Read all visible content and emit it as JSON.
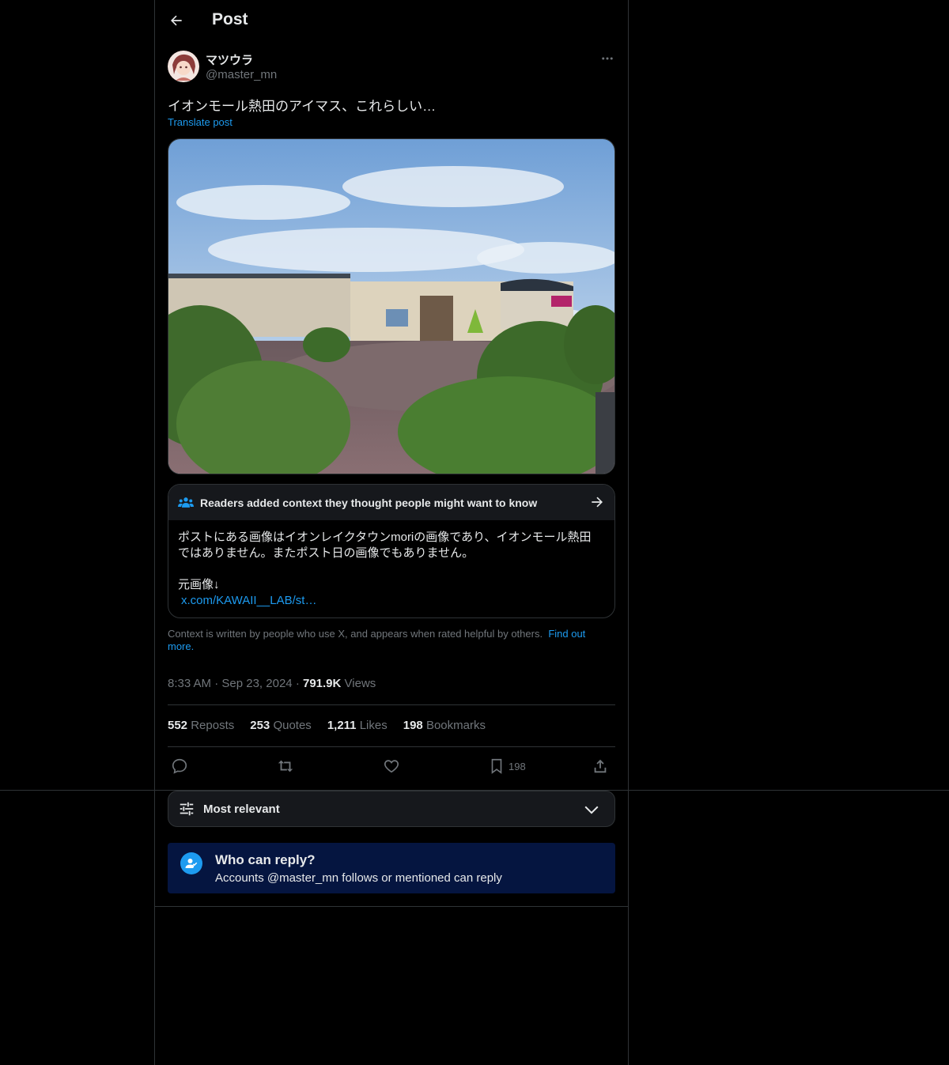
{
  "header": {
    "title": "Post"
  },
  "author": {
    "name": "マツウラ",
    "handle": "@master_mn"
  },
  "post": {
    "text": "イオンモール熱田のアイマス、これらしい…",
    "translate_label": "Translate post"
  },
  "community_note": {
    "title": "Readers added context they thought people might want to know",
    "line1": "ポストにある画像はイオンレイクタウンmoriの画像であり、イオンモール熱田",
    "line2": "ではありません。またポスト日の画像でもありません。",
    "line3": "元画像↓",
    "link": "x.com/KAWAII__LAB/st…"
  },
  "disclaimer": {
    "text": "Context is written by people who use X, and appears when rated helpful by others.",
    "link1": "Find out",
    "link2": "more."
  },
  "meta": {
    "time": "8:33 AM",
    "sep1": "·",
    "date": "Sep 23, 2024",
    "sep2": "·",
    "views_count": "791.9K",
    "views_label": "Views"
  },
  "stats": [
    {
      "count": "552",
      "label": "Reposts"
    },
    {
      "count": "253",
      "label": "Quotes"
    },
    {
      "count": "1,211",
      "label": "Likes"
    },
    {
      "count": "198",
      "label": "Bookmarks"
    }
  ],
  "actions": {
    "bookmark_count": "198"
  },
  "sort": {
    "label": "Most relevant"
  },
  "reply_restriction": {
    "title": "Who can reply?",
    "subtitle": "Accounts @master_mn follows or mentioned can reply"
  },
  "colors": {
    "accent": "#1d9bf0",
    "background": "#000000",
    "muted": "#71767b",
    "border": "#2f3336",
    "reply_box": "#051540"
  }
}
